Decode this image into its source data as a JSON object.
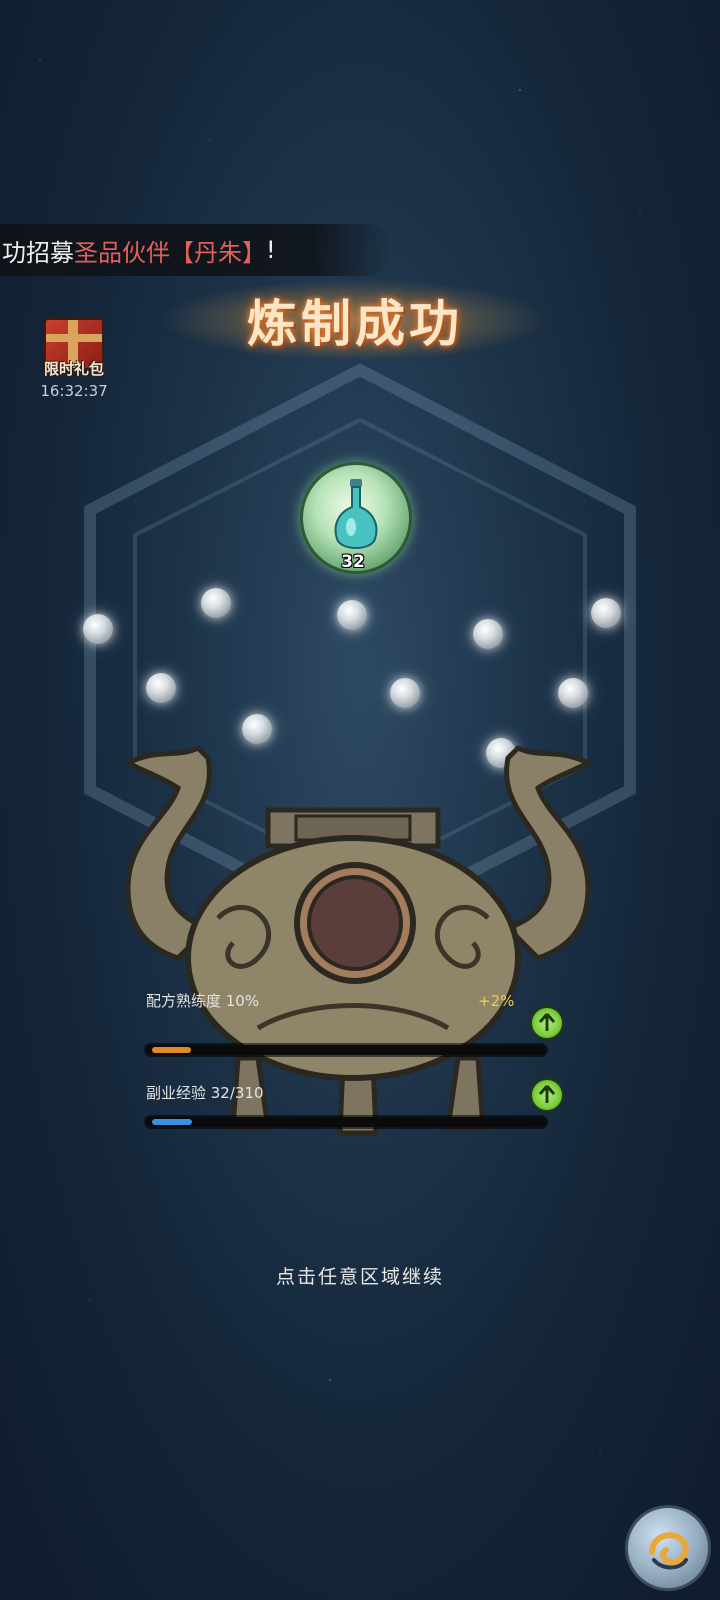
{
  "announcement": {
    "prefix": "功招募",
    "highlight": "圣品伙伴【丹朱】",
    "suffix": "!"
  },
  "result_title": "炼制成功",
  "gift_pack": {
    "label": "限时礼包",
    "timer": "16:32:37"
  },
  "reward": {
    "icon": "potion-bottle-icon",
    "count": "32"
  },
  "stats": [
    {
      "label": "配方熟练度 10%",
      "bonus": "+2%",
      "progress": 0.1,
      "bar_color": "#e08a25"
    },
    {
      "label": "副业经验 32/310",
      "bonus": "",
      "progress": 0.103,
      "bar_color": "#3b8fe0"
    }
  ],
  "continue_hint": "点击任意区域继续",
  "colors": {
    "highlight_red": "#e0605a",
    "bonus_yellow": "#e7d44a"
  }
}
